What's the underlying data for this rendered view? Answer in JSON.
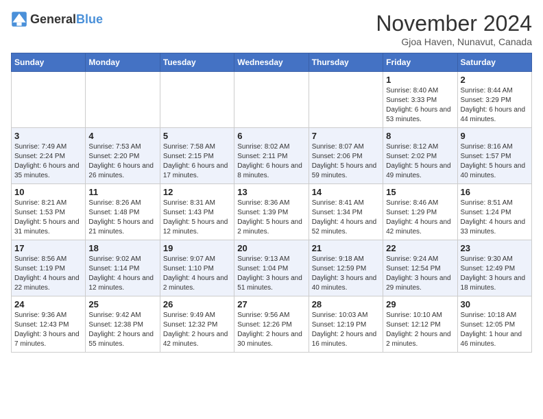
{
  "header": {
    "logo_general": "General",
    "logo_blue": "Blue",
    "month_title": "November 2024",
    "location": "Gjoa Haven, Nunavut, Canada"
  },
  "weekdays": [
    "Sunday",
    "Monday",
    "Tuesday",
    "Wednesday",
    "Thursday",
    "Friday",
    "Saturday"
  ],
  "weeks": [
    [
      {
        "day": "",
        "info": ""
      },
      {
        "day": "",
        "info": ""
      },
      {
        "day": "",
        "info": ""
      },
      {
        "day": "",
        "info": ""
      },
      {
        "day": "",
        "info": ""
      },
      {
        "day": "1",
        "info": "Sunrise: 8:40 AM\nSunset: 3:33 PM\nDaylight: 6 hours and 53 minutes."
      },
      {
        "day": "2",
        "info": "Sunrise: 8:44 AM\nSunset: 3:29 PM\nDaylight: 6 hours and 44 minutes."
      }
    ],
    [
      {
        "day": "3",
        "info": "Sunrise: 7:49 AM\nSunset: 2:24 PM\nDaylight: 6 hours and 35 minutes."
      },
      {
        "day": "4",
        "info": "Sunrise: 7:53 AM\nSunset: 2:20 PM\nDaylight: 6 hours and 26 minutes."
      },
      {
        "day": "5",
        "info": "Sunrise: 7:58 AM\nSunset: 2:15 PM\nDaylight: 6 hours and 17 minutes."
      },
      {
        "day": "6",
        "info": "Sunrise: 8:02 AM\nSunset: 2:11 PM\nDaylight: 6 hours and 8 minutes."
      },
      {
        "day": "7",
        "info": "Sunrise: 8:07 AM\nSunset: 2:06 PM\nDaylight: 5 hours and 59 minutes."
      },
      {
        "day": "8",
        "info": "Sunrise: 8:12 AM\nSunset: 2:02 PM\nDaylight: 5 hours and 49 minutes."
      },
      {
        "day": "9",
        "info": "Sunrise: 8:16 AM\nSunset: 1:57 PM\nDaylight: 5 hours and 40 minutes."
      }
    ],
    [
      {
        "day": "10",
        "info": "Sunrise: 8:21 AM\nSunset: 1:53 PM\nDaylight: 5 hours and 31 minutes."
      },
      {
        "day": "11",
        "info": "Sunrise: 8:26 AM\nSunset: 1:48 PM\nDaylight: 5 hours and 21 minutes."
      },
      {
        "day": "12",
        "info": "Sunrise: 8:31 AM\nSunset: 1:43 PM\nDaylight: 5 hours and 12 minutes."
      },
      {
        "day": "13",
        "info": "Sunrise: 8:36 AM\nSunset: 1:39 PM\nDaylight: 5 hours and 2 minutes."
      },
      {
        "day": "14",
        "info": "Sunrise: 8:41 AM\nSunset: 1:34 PM\nDaylight: 4 hours and 52 minutes."
      },
      {
        "day": "15",
        "info": "Sunrise: 8:46 AM\nSunset: 1:29 PM\nDaylight: 4 hours and 42 minutes."
      },
      {
        "day": "16",
        "info": "Sunrise: 8:51 AM\nSunset: 1:24 PM\nDaylight: 4 hours and 33 minutes."
      }
    ],
    [
      {
        "day": "17",
        "info": "Sunrise: 8:56 AM\nSunset: 1:19 PM\nDaylight: 4 hours and 22 minutes."
      },
      {
        "day": "18",
        "info": "Sunrise: 9:02 AM\nSunset: 1:14 PM\nDaylight: 4 hours and 12 minutes."
      },
      {
        "day": "19",
        "info": "Sunrise: 9:07 AM\nSunset: 1:10 PM\nDaylight: 4 hours and 2 minutes."
      },
      {
        "day": "20",
        "info": "Sunrise: 9:13 AM\nSunset: 1:04 PM\nDaylight: 3 hours and 51 minutes."
      },
      {
        "day": "21",
        "info": "Sunrise: 9:18 AM\nSunset: 12:59 PM\nDaylight: 3 hours and 40 minutes."
      },
      {
        "day": "22",
        "info": "Sunrise: 9:24 AM\nSunset: 12:54 PM\nDaylight: 3 hours and 29 minutes."
      },
      {
        "day": "23",
        "info": "Sunrise: 9:30 AM\nSunset: 12:49 PM\nDaylight: 3 hours and 18 minutes."
      }
    ],
    [
      {
        "day": "24",
        "info": "Sunrise: 9:36 AM\nSunset: 12:43 PM\nDaylight: 3 hours and 7 minutes."
      },
      {
        "day": "25",
        "info": "Sunrise: 9:42 AM\nSunset: 12:38 PM\nDaylight: 2 hours and 55 minutes."
      },
      {
        "day": "26",
        "info": "Sunrise: 9:49 AM\nSunset: 12:32 PM\nDaylight: 2 hours and 42 minutes."
      },
      {
        "day": "27",
        "info": "Sunrise: 9:56 AM\nSunset: 12:26 PM\nDaylight: 2 hours and 30 minutes."
      },
      {
        "day": "28",
        "info": "Sunrise: 10:03 AM\nSunset: 12:19 PM\nDaylight: 2 hours and 16 minutes."
      },
      {
        "day": "29",
        "info": "Sunrise: 10:10 AM\nSunset: 12:12 PM\nDaylight: 2 hours and 2 minutes."
      },
      {
        "day": "30",
        "info": "Sunrise: 10:18 AM\nSunset: 12:05 PM\nDaylight: 1 hour and 46 minutes."
      }
    ]
  ]
}
